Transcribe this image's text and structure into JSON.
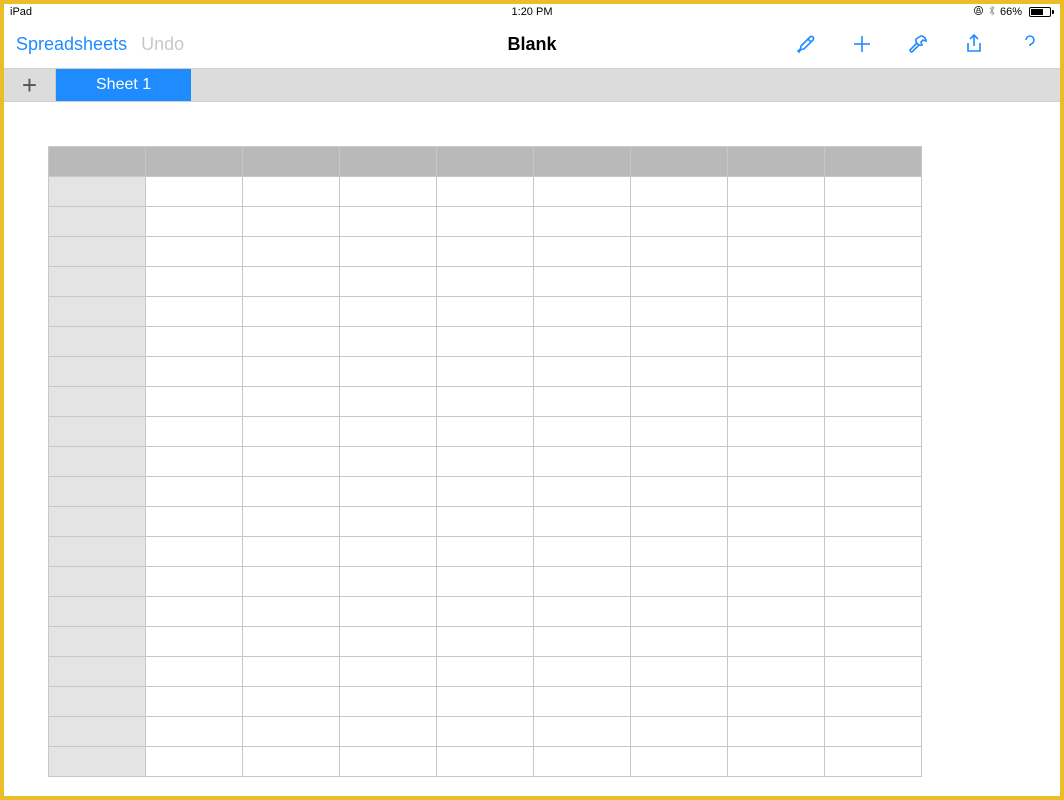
{
  "status": {
    "device": "iPad",
    "time": "1:20 PM",
    "battery_pct": "66%"
  },
  "toolbar": {
    "back_label": "Spreadsheets",
    "undo_label": "Undo",
    "title": "Blank"
  },
  "tabs": {
    "add_glyph": "+",
    "active_label": "Sheet 1"
  },
  "grid": {
    "columns": 9,
    "rows": 20
  },
  "icons": {
    "plus": "+"
  }
}
